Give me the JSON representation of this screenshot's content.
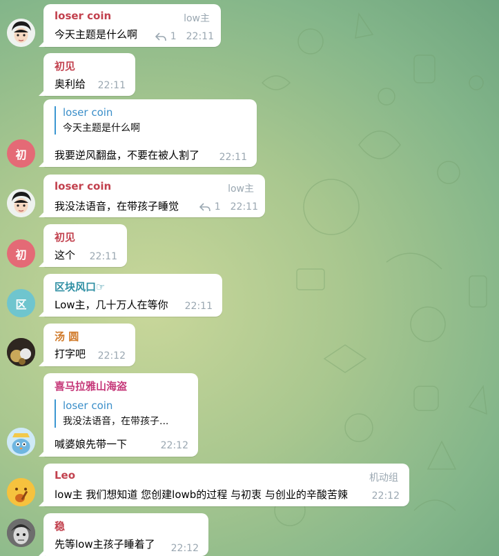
{
  "colors": {
    "accent_red": "#c2414e",
    "accent_teal": "#2f8fa3",
    "accent_orange": "#d07a2a",
    "accent_pink": "#c6397a",
    "avatar_red": "#e46a76",
    "avatar_teal": "#6fc5ce",
    "meta_gray": "#9aa7b1",
    "quote_blue": "#3a8ec9"
  },
  "messages": [
    {
      "sender": "loser coin",
      "text": "今天主题是什么啊",
      "rank": "low主",
      "replies": "1",
      "time": "22:11"
    },
    {
      "sender": "初见",
      "text": "奥利给",
      "time": "22:11"
    },
    {
      "quote_name": "loser coin",
      "quote_text": "今天主题是什么啊",
      "text": "我要逆风翻盘，不要在被人割了",
      "time": "22:11",
      "avatar": "初"
    },
    {
      "sender": "loser coin",
      "text": "我没法语音，在带孩子睡觉",
      "rank": "low主",
      "replies": "1",
      "time": "22:11"
    },
    {
      "sender": "初见",
      "text": "这个",
      "time": "22:11",
      "avatar": "初"
    },
    {
      "sender": "区块风口☞",
      "text": "Low主，几十万人在等你",
      "time": "22:11",
      "avatar": "区"
    },
    {
      "sender": "汤 圆",
      "text": "打字吧",
      "time": "22:12"
    },
    {
      "sender": "喜马拉雅山海盗",
      "quote_name": "loser coin",
      "quote_text": "我没法语音，在带孩子...",
      "text": "喊婆娘先带一下",
      "time": "22:12"
    },
    {
      "sender": "Leo",
      "text": "low主 我们想知道 您创建lowb的过程 与初衷 与创业的辛酸苦辣",
      "rank": "机动组",
      "time": "22:12"
    },
    {
      "sender": "稳",
      "text": "先等low主孩子睡着了",
      "time": "22:12"
    }
  ]
}
